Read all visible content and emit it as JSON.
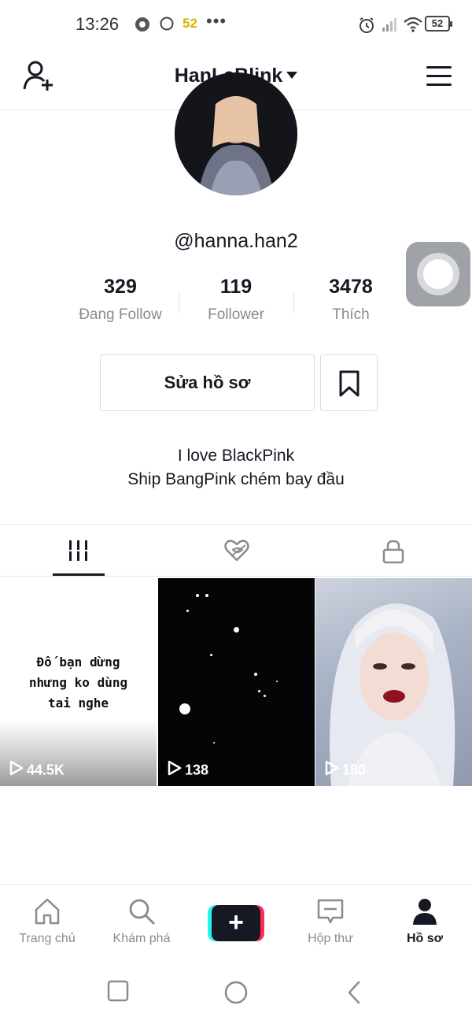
{
  "status_bar": {
    "time": "13:26",
    "badge": "52",
    "dots": "•••",
    "battery": "52"
  },
  "header": {
    "account_name": "HanLaBlink"
  },
  "profile": {
    "username": "@hanna.han2",
    "stats": [
      {
        "value": "329",
        "label": "Đang Follow"
      },
      {
        "value": "119",
        "label": "Follower"
      },
      {
        "value": "3478",
        "label": "Thích"
      }
    ],
    "edit_profile_label": "Sửa hồ sơ",
    "bio": [
      "I love BlackPink",
      "Ship BangPink chém bay đầu"
    ]
  },
  "tabs": [
    {
      "icon": "grid-icon",
      "active": true
    },
    {
      "icon": "heart-hidden-icon",
      "active": false
    },
    {
      "icon": "lock-icon",
      "active": false
    }
  ],
  "videos": [
    {
      "views": "44.5K",
      "caption": [
        "Đố bạn dừng",
        "nhưng ko dùng",
        "tai nghe"
      ]
    },
    {
      "views": "138"
    },
    {
      "views": "180"
    }
  ],
  "bottom_nav": [
    {
      "label": "Trang chủ",
      "icon": "home-icon",
      "active": false
    },
    {
      "label": "Khám phá",
      "icon": "search-icon",
      "active": false
    },
    {
      "label": "",
      "icon": "plus-icon",
      "active": false
    },
    {
      "label": "Hộp thư",
      "icon": "inbox-icon",
      "active": false
    },
    {
      "label": "Hồ sơ",
      "icon": "profile-icon",
      "active": true
    }
  ],
  "colors": {
    "text_primary": "#161823",
    "text_secondary": "#8a8b91",
    "accent_red": "#fe2c55",
    "accent_cyan": "#25f4ee",
    "status_badge": "#d6b400"
  }
}
